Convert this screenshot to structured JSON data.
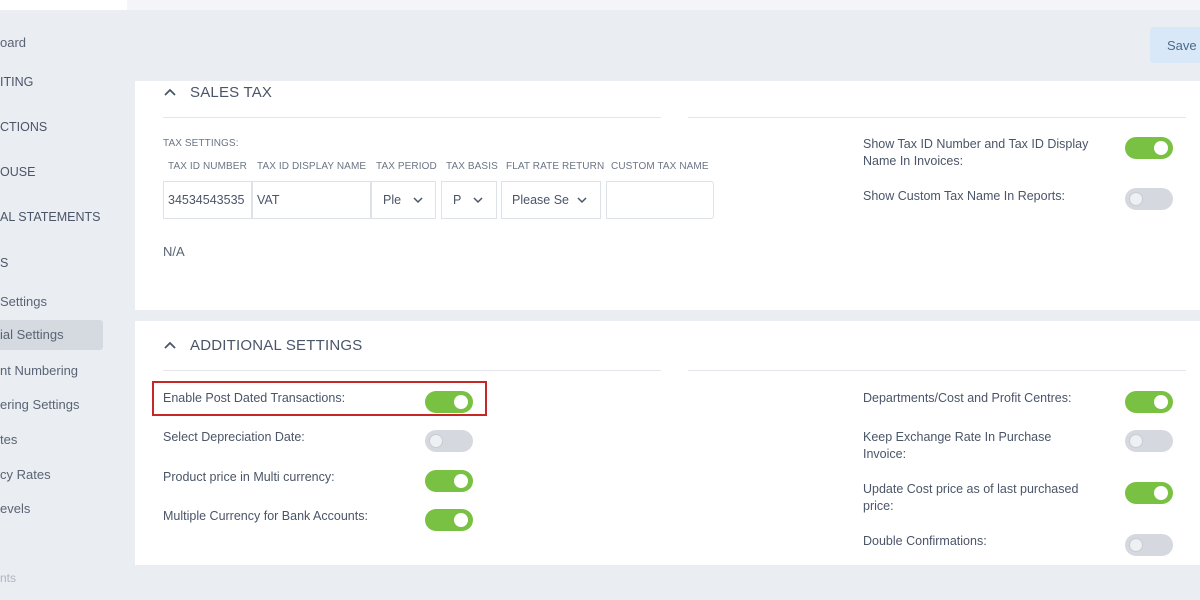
{
  "sidebar": {
    "items": [
      {
        "label": "oard"
      },
      {
        "label": "ITING"
      },
      {
        "label": "CTIONS"
      },
      {
        "label": "OUSE"
      },
      {
        "label": "AL STATEMENTS"
      },
      {
        "label": "S"
      },
      {
        "label": "Settings"
      },
      {
        "label": "ial Settings"
      },
      {
        "label": "nt Numbering"
      },
      {
        "label": "ering Settings"
      },
      {
        "label": "tes"
      },
      {
        "label": "cy Rates"
      },
      {
        "label": "evels"
      },
      {
        "label": "nts"
      }
    ]
  },
  "header": {
    "save_label": "Save"
  },
  "sales_tax": {
    "title": "SALES TAX",
    "tax_settings_label": "TAX SETTINGS:",
    "columns": [
      "TAX ID NUMBER",
      "TAX ID DISPLAY NAME",
      "TAX PERIOD",
      "TAX BASIS",
      "FLAT RATE RETURN",
      "CUSTOM TAX NAME"
    ],
    "row": {
      "tax_id_number": "34534543535",
      "tax_id_display_name": "VAT",
      "tax_period": "Ple",
      "tax_basis": "P",
      "flat_rate_return": "Please Se",
      "custom_tax_name": ""
    },
    "na_text": "N/A",
    "options": [
      {
        "label": "Show Tax ID Number and Tax ID Display Name In Invoices:",
        "enabled": true
      },
      {
        "label": "Show Custom Tax Name In Reports:",
        "enabled": false
      }
    ]
  },
  "additional_settings": {
    "title": "ADDITIONAL SETTINGS",
    "left_options": [
      {
        "label": "Enable Post Dated Transactions:",
        "enabled": true
      },
      {
        "label": "Select Depreciation Date:",
        "enabled": false
      },
      {
        "label": "Product price in Multi currency:",
        "enabled": true
      },
      {
        "label": "Multiple Currency for Bank Accounts:",
        "enabled": true
      }
    ],
    "right_options": [
      {
        "label": "Departments/Cost and Profit Centres:",
        "enabled": true
      },
      {
        "label": "Keep Exchange Rate In Purchase Invoice:",
        "enabled": false
      },
      {
        "label": "Update Cost price as of last purchased price:",
        "enabled": true
      },
      {
        "label": "Double Confirmations:",
        "enabled": false
      }
    ]
  },
  "colors": {
    "toggle_on": "#79c143",
    "toggle_off": "#d5d9df",
    "highlight": "#c62828",
    "save_button": "#d8e8f8"
  },
  "icons": {
    "collapse": "chevron-up-icon",
    "dropdown": "chevron-down-icon"
  }
}
